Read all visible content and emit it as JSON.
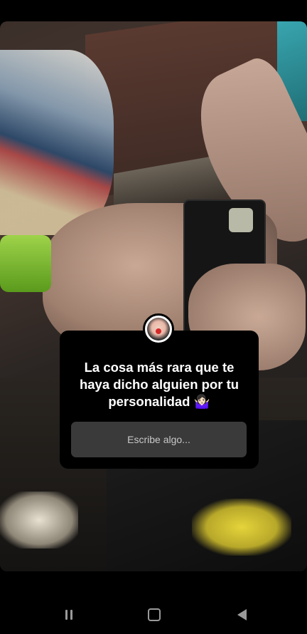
{
  "story": {
    "question_sticker": {
      "prompt": "La cosa más rara que te haya dicho alguien por tu personalidad 🤷🏻‍♀️",
      "answer_placeholder": "Escribe algo...",
      "avatar_icon": "user-avatar-clown"
    }
  },
  "system_nav": {
    "recents_icon": "recents-icon",
    "home_icon": "home-icon",
    "back_icon": "back-icon"
  }
}
